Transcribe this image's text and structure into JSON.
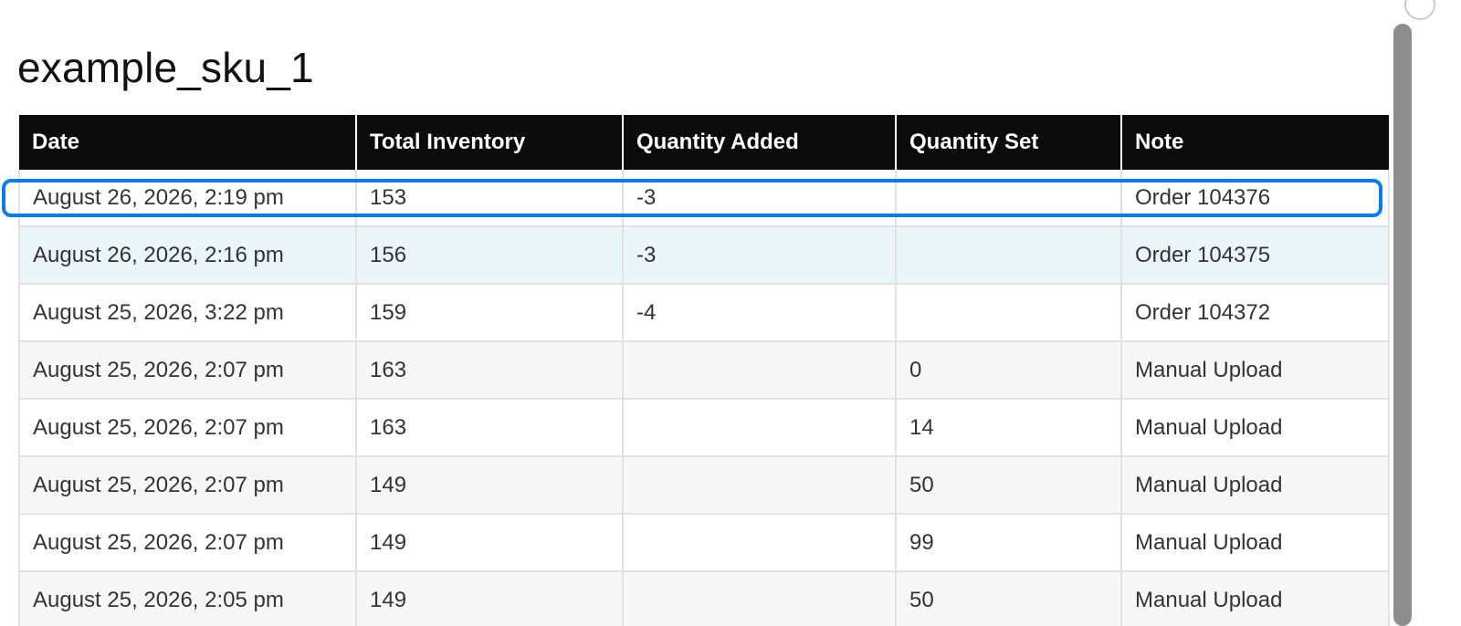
{
  "page": {
    "title": "example_sku_1"
  },
  "table": {
    "headers": {
      "date": "Date",
      "total_inventory": "Total Inventory",
      "quantity_added": "Quantity Added",
      "quantity_set": "Quantity Set",
      "note": "Note"
    },
    "rows": [
      {
        "date": "August 26, 2026, 2:19 pm",
        "total_inventory": "153",
        "quantity_added": "-3",
        "quantity_set": "",
        "note": "Order 104376",
        "highlighted": true
      },
      {
        "date": "August 26, 2026, 2:16 pm",
        "total_inventory": "156",
        "quantity_added": "-3",
        "quantity_set": "",
        "note": "Order 104375",
        "hovered": true
      },
      {
        "date": "August 25, 2026, 3:22 pm",
        "total_inventory": "159",
        "quantity_added": "-4",
        "quantity_set": "",
        "note": "Order 104372"
      },
      {
        "date": "August 25, 2026, 2:07 pm",
        "total_inventory": "163",
        "quantity_added": "",
        "quantity_set": "0",
        "note": "Manual Upload"
      },
      {
        "date": "August 25, 2026, 2:07 pm",
        "total_inventory": "163",
        "quantity_added": "",
        "quantity_set": "14",
        "note": "Manual Upload"
      },
      {
        "date": "August 25, 2026, 2:07 pm",
        "total_inventory": "149",
        "quantity_added": "",
        "quantity_set": "50",
        "note": "Manual Upload"
      },
      {
        "date": "August 25, 2026, 2:07 pm",
        "total_inventory": "149",
        "quantity_added": "",
        "quantity_set": "99",
        "note": "Manual Upload"
      },
      {
        "date": "August 25, 2026, 2:05 pm",
        "total_inventory": "149",
        "quantity_added": "",
        "quantity_set": "50",
        "note": "Manual Upload"
      }
    ]
  },
  "colors": {
    "header_background": "#0b0b0b",
    "header_text": "#ffffff",
    "row_hover": "#eaf6fa",
    "row_alt": "#f7f7f7",
    "selection_outline": "#0a7cf0",
    "scrollbar": "#8e8e8e"
  }
}
